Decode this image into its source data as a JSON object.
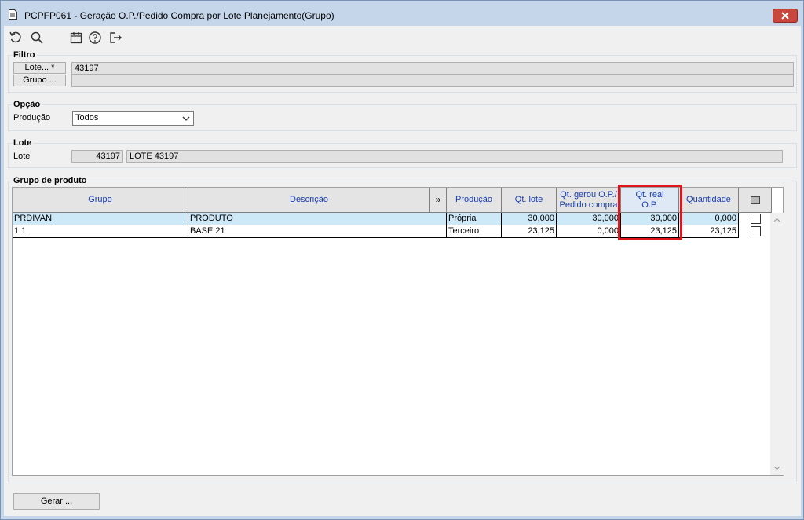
{
  "window": {
    "title": "PCPFP061 - Geração O.P./Pedido Compra por Lote Planejamento(Grupo)",
    "title_icon": "document-icon",
    "close_icon": "close-icon"
  },
  "toolbar": {
    "items": [
      "undo-icon",
      "search-icon",
      "calendar-icon",
      "help-icon",
      "exit-icon"
    ]
  },
  "filtro": {
    "legend": "Filtro",
    "lote_button": "Lote... *",
    "lote_value": "43197",
    "grupo_button": "Grupo ...",
    "grupo_value": ""
  },
  "opcao": {
    "legend": "Opção",
    "producao_label": "Produção",
    "producao_value": "Todos"
  },
  "lote": {
    "legend": "Lote",
    "label": "Lote",
    "code": "43197",
    "description": "LOTE 43197"
  },
  "grupo_produto": {
    "legend": "Grupo de produto",
    "columns": {
      "grupo": "Grupo",
      "descricao": "Descrição",
      "expand": "»",
      "producao": "Produção",
      "qt_lote": "Qt. lote",
      "qt_gerou": "Qt. gerou O.P./ Pedido compra",
      "qt_real": "Qt. real O.P.",
      "quantidade": "Quantidade"
    },
    "rows": [
      {
        "grupo": "PRDIVAN",
        "descricao": "PRODUTO",
        "producao": "Própria",
        "qt_lote": "30,000",
        "qt_gerou": "30,000",
        "qt_real": "30,000",
        "quantidade": "0,000",
        "checked": false
      },
      {
        "grupo": "1 1",
        "descricao": "BASE 21",
        "producao": "Terceiro",
        "qt_lote": "23,125",
        "qt_gerou": "0,000",
        "qt_real": "23,125",
        "quantidade": "23,125",
        "checked": false
      }
    ]
  },
  "footer": {
    "gerar_button": "Gerar ..."
  },
  "colors": {
    "accent_header_text": "#1a3fb0",
    "highlight": "#e0151b",
    "selected_row": "#cde8f7"
  }
}
